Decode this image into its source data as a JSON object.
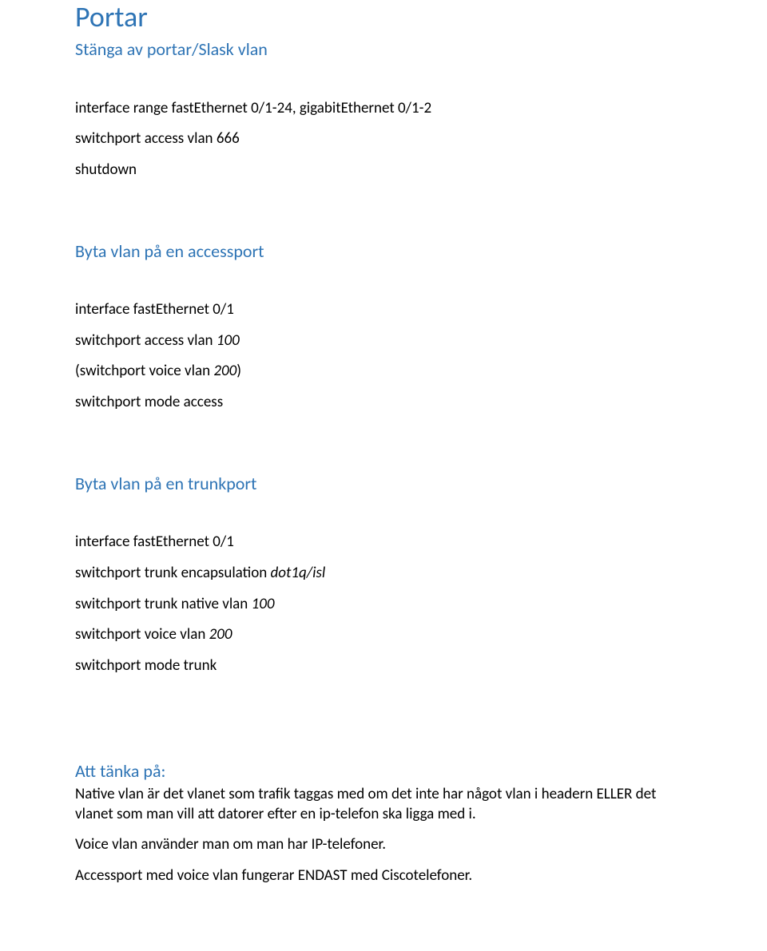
{
  "title": "Portar",
  "sections": [
    {
      "heading": "Stänga av portar/Slask vlan",
      "lines": [
        {
          "parts": [
            {
              "text": "interface range fastEthernet 0/1-24, gigabitEthernet 0/1-2",
              "italic": false
            }
          ]
        },
        {
          "parts": [
            {
              "text": "switchport access vlan 666",
              "italic": false
            }
          ]
        },
        {
          "parts": [
            {
              "text": "shutdown",
              "italic": false
            }
          ]
        }
      ]
    },
    {
      "heading": "Byta vlan på en accessport",
      "lines": [
        {
          "parts": [
            {
              "text": "interface fastEthernet 0/1",
              "italic": false
            }
          ]
        },
        {
          "parts": [
            {
              "text": "switchport access vlan ",
              "italic": false
            },
            {
              "text": "100",
              "italic": true
            }
          ]
        },
        {
          "parts": [
            {
              "text": "(switchport voice vlan ",
              "italic": false
            },
            {
              "text": "200",
              "italic": true
            },
            {
              "text": ")",
              "italic": false
            }
          ]
        },
        {
          "parts": [
            {
              "text": "switchport mode access",
              "italic": false
            }
          ]
        }
      ]
    },
    {
      "heading": "Byta vlan på en trunkport",
      "lines": [
        {
          "parts": [
            {
              "text": "interface fastEthernet 0/1",
              "italic": false
            }
          ]
        },
        {
          "parts": [
            {
              "text": "switchport trunk encapsulation ",
              "italic": false
            },
            {
              "text": "dot1q/isl",
              "italic": true
            }
          ]
        },
        {
          "parts": [
            {
              "text": "switchport trunk native vlan ",
              "italic": false
            },
            {
              "text": "100",
              "italic": true
            }
          ]
        },
        {
          "parts": [
            {
              "text": "switchport voice vlan ",
              "italic": false
            },
            {
              "text": "200",
              "italic": true
            }
          ]
        },
        {
          "parts": [
            {
              "text": "switchport mode trunk",
              "italic": false
            }
          ]
        }
      ]
    }
  ],
  "notes_heading": "Att tänka på:",
  "notes": [
    "Native vlan är det vlanet som trafik taggas med om det inte har något vlan i headern ELLER det vlanet som man vill att datorer efter en ip-telefon ska ligga med i.",
    "Voice vlan använder man om man har IP-telefoner.",
    "Accessport med voice vlan fungerar ENDAST med Ciscotelefoner."
  ]
}
